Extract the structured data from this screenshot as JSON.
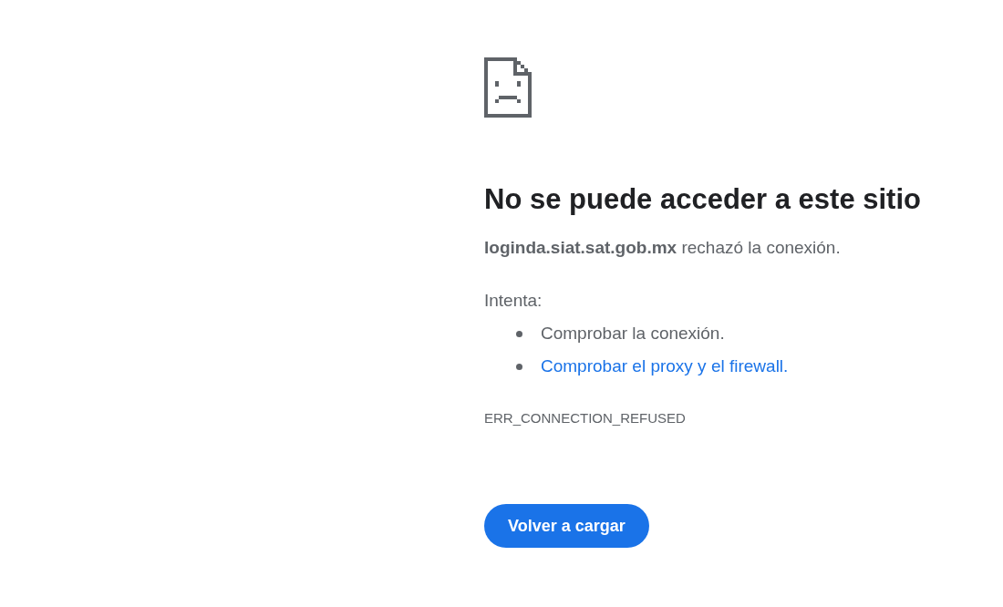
{
  "title": "No se puede acceder a este sitio",
  "message": "**loginda.siat.sat.gob.mx** rechazó la conexión.",
  "suggestions_heading": "Intenta:",
  "suggestions": [
    {
      "text": "Comprobar la conexión.",
      "kind": "text"
    },
    {
      "text": "Comprobar el proxy y el firewall.",
      "kind": "link"
    }
  ],
  "error_code": "ERR_CONNECTION_REFUSED",
  "button": "Volver a cargar"
}
